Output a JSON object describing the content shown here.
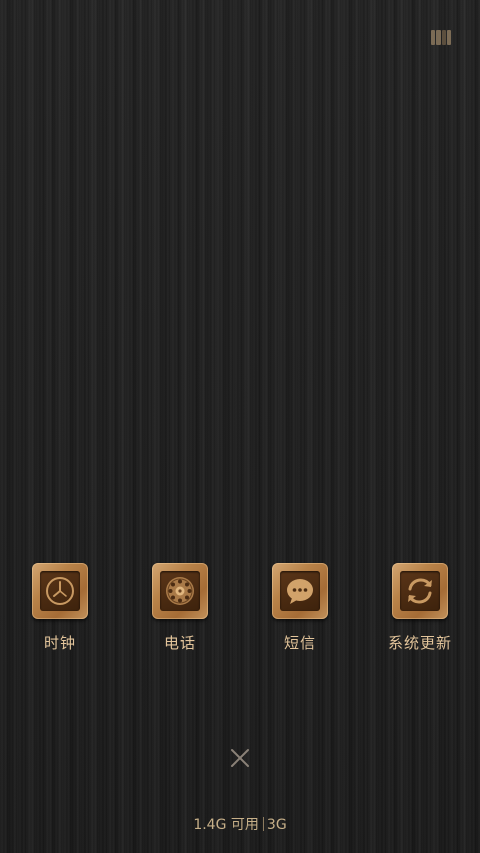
{
  "top_bar": {
    "manage_icon": "recent-apps-manage-icon"
  },
  "apps": [
    {
      "label": "时钟",
      "icon": "clock-icon"
    },
    {
      "label": "电话",
      "icon": "phone-dial-icon"
    },
    {
      "label": "短信",
      "icon": "message-bubble-icon"
    },
    {
      "label": "系统更新",
      "icon": "refresh-arrows-icon"
    }
  ],
  "close": {
    "icon": "close-icon"
  },
  "status": {
    "memory_available": "1.4G 可用",
    "network": "3G"
  },
  "colors": {
    "label_text": "#e3c59b",
    "wood_tile": "#b98349",
    "inner_tile": "#4a2b12",
    "glyph": "#c89962"
  }
}
